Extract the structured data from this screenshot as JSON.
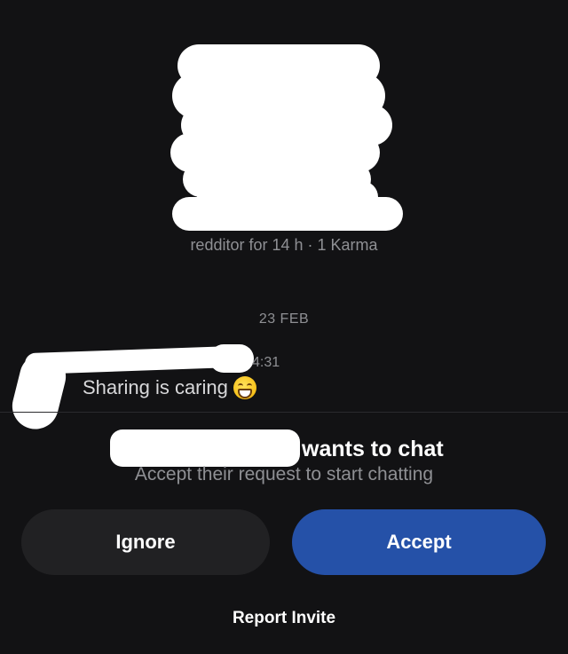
{
  "profile": {
    "meta": "redditor for 14 h · 1 Karma"
  },
  "conversation": {
    "date": "23 FEB",
    "messages": [
      {
        "time": "4:31",
        "text": "Sharing is caring",
        "emoji": "grinning-face-with-smiling-eyes-icon"
      }
    ]
  },
  "invite": {
    "title": "wants to chat",
    "subtitle": "Accept their request to start chatting",
    "ignore_label": "Ignore",
    "accept_label": "Accept",
    "report_label": "Report Invite"
  },
  "colors": {
    "background": "#121214",
    "accept_button": "#2551a8",
    "ignore_button": "#212123",
    "muted_text": "#8f9094"
  }
}
